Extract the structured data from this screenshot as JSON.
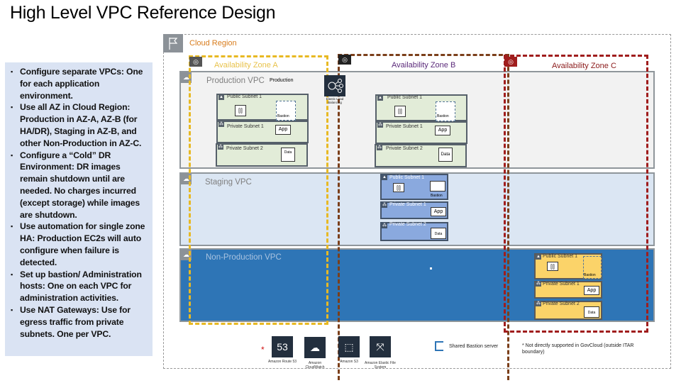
{
  "title": "High Level VPC Reference Design",
  "notes": [
    "Configure separate VPCs: One for each application environment.",
    "Use all AZ in Cloud Region: Production in AZ-A, AZ-B (for HA/DR), Staging in AZ-B, and other Non-Production in AZ-C.",
    "Configure a “Cold” DR Environment: DR images remain shutdown until are needed. No charges incurred (except storage) while images are shutdown.",
    "Use automation for single zone HA: Production EC2s will auto configure when failure is detected.",
    " Set up bastion/ Administration hosts: One on each VPC for administration activities.",
    "Use NAT Gateways: Use for egress traffic from private subnets. One per VPC."
  ],
  "region": {
    "label": "Cloud Region",
    "icon": "flag-icon"
  },
  "zones": {
    "a": {
      "label": "Availability Zone A",
      "color": "#e8b923"
    },
    "b": {
      "label": "Availability Zone B",
      "color": "#7b3f1a"
    },
    "c": {
      "label": "Availability Zone C",
      "color": "#a01d1d"
    }
  },
  "vpcs": {
    "production": {
      "label": "Production VPC",
      "tag": "Production"
    },
    "staging": {
      "label": "Staging VPC"
    },
    "nonprod": {
      "label": "Non-Production VPC"
    }
  },
  "elb": {
    "label": "Elastic Load Balancing"
  },
  "subnets": {
    "public": "Public Subnet 1",
    "private1": "Private Subnet 1",
    "private2": "Private Subnet 2",
    "bastion": "Bastion",
    "app": "App",
    "data": "Data",
    "nat": "[|]"
  },
  "services": [
    {
      "label": "Amazon Route 53",
      "icon": "route53-icon",
      "glyph": "53"
    },
    {
      "label": "Amazon CloudWatch",
      "icon": "cloudwatch-icon",
      "glyph": "☁"
    },
    {
      "label": "Amazon S3",
      "icon": "s3-icon",
      "glyph": "⬚"
    },
    {
      "label": "Amazon Elastic File System",
      "icon": "efs-icon",
      "glyph": "⤧"
    }
  ],
  "asterisk": "*",
  "legend": {
    "bastion": "Shared Bastion server",
    "footnote": "* Not directly supported in GovCloud (outside ITAR boundary)"
  }
}
